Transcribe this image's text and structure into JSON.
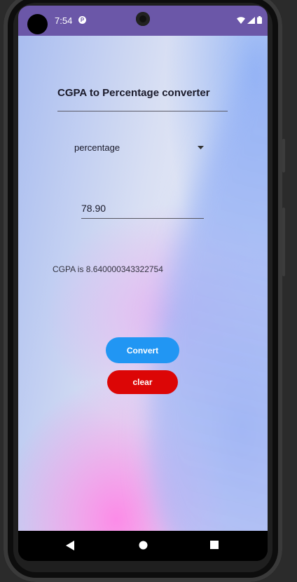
{
  "status_bar": {
    "time": "7:54",
    "notification_icon": "app-notification-icon",
    "icons": [
      "wifi-icon",
      "cell-signal-icon",
      "battery-icon"
    ],
    "color": "#6b57a8"
  },
  "app": {
    "title": "CGPA to Percentage converter",
    "dropdown": {
      "selected": "percentage"
    },
    "input": {
      "value": "78.90"
    },
    "result_text": "CGPA is 8.640000343322754",
    "buttons": {
      "convert": {
        "label": "Convert",
        "color": "#2196f3"
      },
      "clear": {
        "label": "clear",
        "color": "#dc0606"
      }
    }
  },
  "nav_bar": {
    "buttons": [
      "back-icon",
      "home-icon",
      "recents-icon"
    ]
  }
}
